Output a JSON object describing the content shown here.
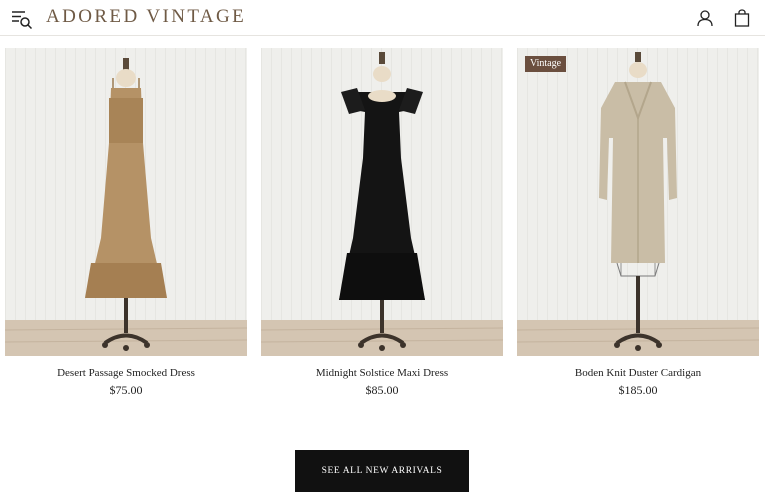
{
  "header": {
    "logo": "ADORED VINTAGE",
    "icons": {
      "menu": "menu-search-icon",
      "account": "user-icon",
      "cart": "shopping-bag-icon"
    }
  },
  "products": [
    {
      "name": "Desert Passage Smocked Dress",
      "price": "$75.00",
      "badge": "",
      "image": "dress-form-tan-smocked-dress"
    },
    {
      "name": "Midnight Solstice Maxi Dress",
      "price": "$85.00",
      "badge": "",
      "image": "dress-form-black-maxi-dress"
    },
    {
      "name": "Boden Knit Duster Cardigan",
      "price": "$185.00",
      "badge": "Vintage",
      "image": "dress-form-knit-duster-cardigan"
    }
  ],
  "cta": {
    "label": "SEE ALL NEW ARRIVALS"
  },
  "colors": {
    "logo": "#6f5a45",
    "badge": "#6b4f3f",
    "cta_bg": "#111111",
    "wall": "#eeeeeb",
    "floor": "#d3c4b0"
  }
}
